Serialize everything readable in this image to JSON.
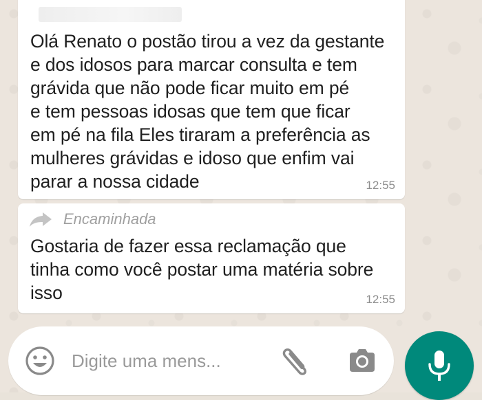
{
  "messages": [
    {
      "text": "Olá Renato o postão tirou a vez da gestante\ne dos idosos para marcar consulta e tem\ngrávida que não pode ficar muito em pé\ne tem pessoas idosas que tem que ficar\nem pé na fila Eles tiraram a preferência as\nmulheres grávidas e idoso que enfim vai\nparar a nossa cidade",
      "time": "12:55"
    },
    {
      "forwarded_label": "Encaminhada",
      "text": "Gostaria de fazer essa reclamação que\ntinha como você postar uma matéria sobre\nisso",
      "time": "12:55"
    }
  ],
  "composer": {
    "placeholder": "Digite uma mens..."
  },
  "icons": {
    "forward": "forward-arrow-icon",
    "emoji": "emoji-icon",
    "attach": "paperclip-icon",
    "camera": "camera-icon",
    "mic": "microphone-icon"
  },
  "colors": {
    "accent": "#00897b",
    "bubble": "#ffffff",
    "wallpaper": "#ece5dd",
    "timestamp": "#8e8e8e"
  }
}
